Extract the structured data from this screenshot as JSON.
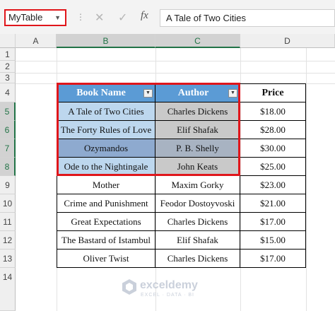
{
  "formula_bar": {
    "name_box": "MyTable",
    "cancel_glyph": "✕",
    "enter_glyph": "✓",
    "fx_label": "fx",
    "formula_value": "A Tale of Two Cities"
  },
  "columns": [
    "A",
    "B",
    "C",
    "D"
  ],
  "rows": [
    "1",
    "2",
    "3",
    "4",
    "5",
    "6",
    "7",
    "8",
    "9",
    "10",
    "11",
    "12",
    "13",
    "14"
  ],
  "table": {
    "headers": {
      "book": "Book Name",
      "author": "Author",
      "price": "Price"
    },
    "data": [
      {
        "book": "A Tale of Two Cities",
        "author": "Charles Dickens",
        "price": "$18.00"
      },
      {
        "book": "The Forty Rules of Love",
        "author": "Elif Shafak",
        "price": "$28.00"
      },
      {
        "book": "Ozymandos",
        "author": "P. B. Shelly",
        "price": "$30.00"
      },
      {
        "book": "Ode to the Nightingale",
        "author": "John Keats",
        "price": "$25.00"
      },
      {
        "book": "Mother",
        "author": "Maxim Gorky",
        "price": "$23.00"
      },
      {
        "book": "Crime and Punishment",
        "author": "Feodor Dostoyvoski",
        "price": "$21.00"
      },
      {
        "book": "Great Expectations",
        "author": "Charles Dickens",
        "price": "$17.00"
      },
      {
        "book": "The Bastard of Istambul",
        "author": "Elif Shafak",
        "price": "$15.00"
      },
      {
        "book": "Oliver Twist",
        "author": "Charles Dickens",
        "price": "$17.00"
      }
    ]
  },
  "watermark": {
    "title": "exceldemy",
    "subtitle": "EXCEL · DATA · BI"
  },
  "colors": {
    "table_header": "#5b9bd5",
    "selection_border": "#e0161b",
    "header_selected": "#217346"
  },
  "icons": {
    "dropdown": "chevron-down-icon",
    "filter": "filter-dropdown-icon",
    "logo": "exceldemy-logo-icon"
  }
}
